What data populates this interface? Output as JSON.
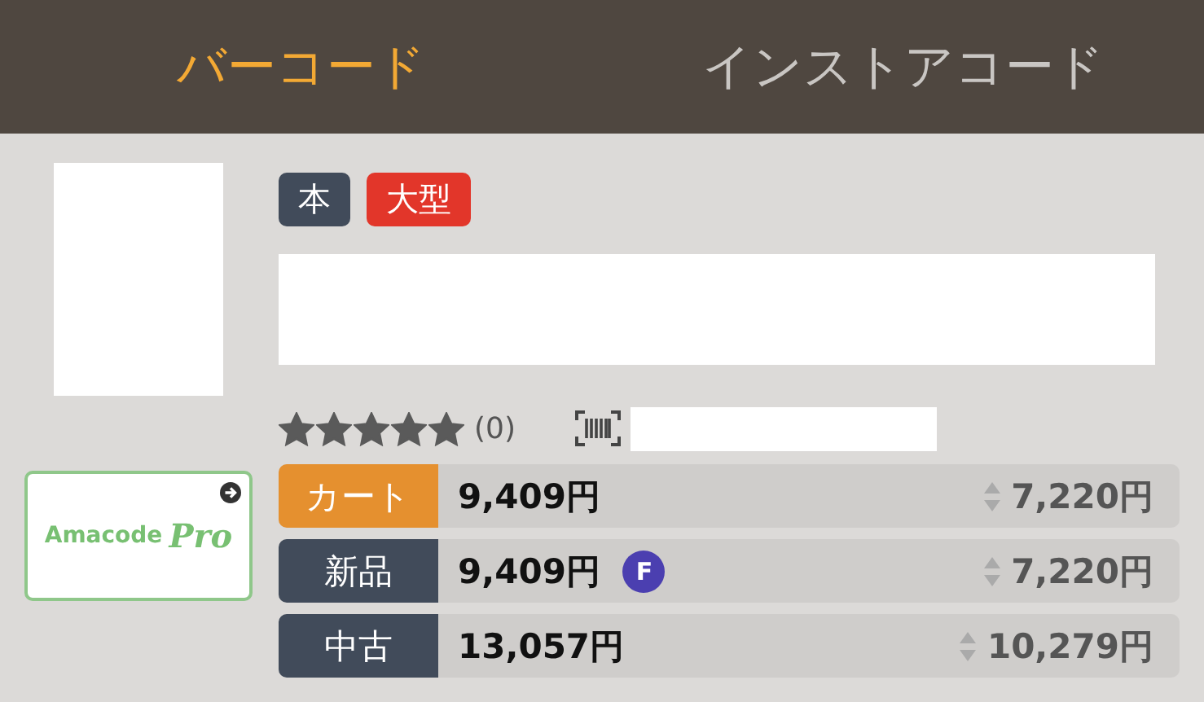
{
  "tabs": [
    {
      "label": "バーコード",
      "selected": true
    },
    {
      "label": "インストアコード",
      "selected": false
    }
  ],
  "tags": [
    {
      "label": "本",
      "color": "#414b5a"
    },
    {
      "label": "大型",
      "color": "#e2362a"
    }
  ],
  "rating": {
    "stars": 5,
    "count": "(0)"
  },
  "promo": {
    "brand": "Amacode",
    "badge": "Pro"
  },
  "prices": [
    {
      "label": "カート",
      "color": "#e5902f",
      "price": "9,409円",
      "fba": false,
      "compare": "7,220円"
    },
    {
      "label": "新品",
      "color": "#414b5a",
      "price": "9,409円",
      "fba": true,
      "fba_label": "F",
      "compare": "7,220円"
    },
    {
      "label": "中古",
      "color": "#414b5a",
      "price": "13,057円",
      "fba": false,
      "compare": "10,279円"
    }
  ]
}
